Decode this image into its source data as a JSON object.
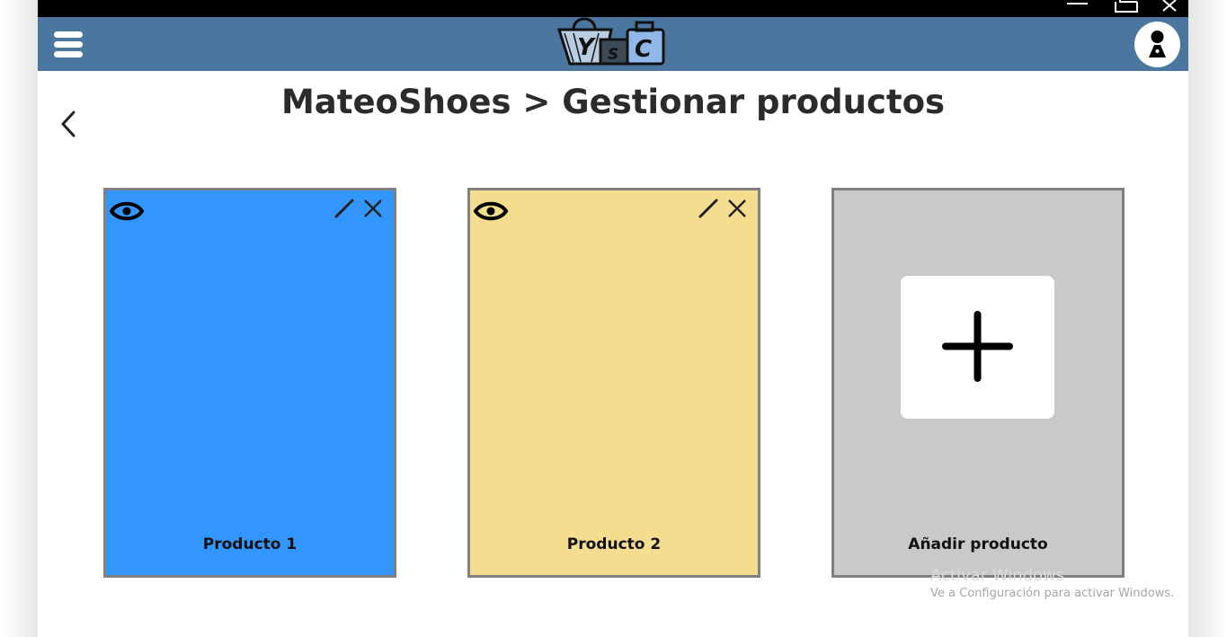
{
  "window": {
    "controls": [
      "minimize-icon",
      "maximize-icon",
      "close-icon"
    ]
  },
  "header": {
    "menu_icon": "hamburger-menu-icon",
    "logo_text": "YSC",
    "user_icon": "user-avatar-icon",
    "bar_color": "#4a76a0"
  },
  "page": {
    "back_icon": "chevron-left-icon",
    "title": "MateoShoes > Gestionar productos"
  },
  "products": [
    {
      "label": "Producto 1",
      "color": "#3396fe",
      "icons": [
        "eye-icon",
        "pencil-icon",
        "close-icon"
      ]
    },
    {
      "label": "Producto 2",
      "color": "#f5dd8f",
      "icons": [
        "eye-icon",
        "pencil-icon",
        "close-icon"
      ]
    }
  ],
  "add_card": {
    "label": "Añadir producto",
    "color": "#c9c9c9",
    "icon": "plus-icon"
  },
  "watermark": {
    "title": "Activar Windows",
    "subtitle": "Ve a Configuración para activar Windows."
  }
}
